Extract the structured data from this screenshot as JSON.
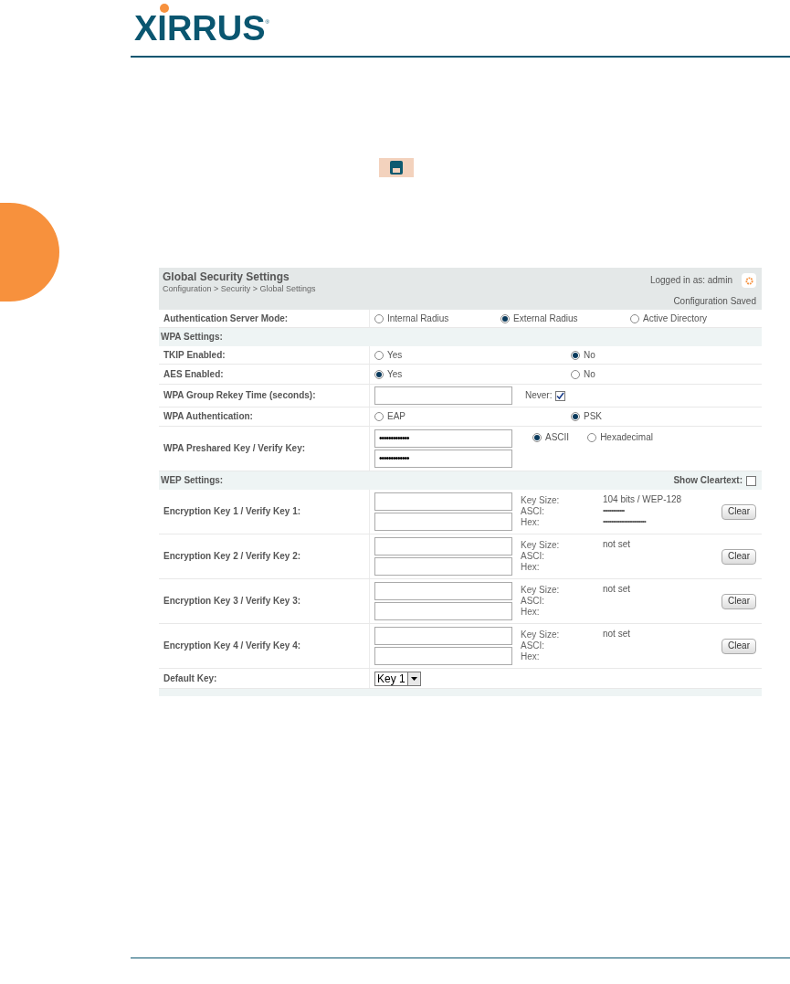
{
  "logo": {
    "name": "XIRRUS",
    "mark": "®"
  },
  "panel": {
    "title": "Global Security Settings",
    "breadcrumb": "Configuration > Security > Global Settings",
    "logged_in": "Logged in as: admin",
    "status": "Configuration Saved"
  },
  "auth_mode": {
    "label": "Authentication Server Mode:",
    "options": [
      {
        "label": "Internal Radius",
        "selected": false
      },
      {
        "label": "External Radius",
        "selected": true
      },
      {
        "label": "Active Directory",
        "selected": false
      }
    ]
  },
  "wpa_section": "WPA Settings:",
  "tkip": {
    "label": "TKIP Enabled:",
    "options": [
      {
        "label": "Yes",
        "selected": false
      },
      {
        "label": "No",
        "selected": true
      }
    ]
  },
  "aes": {
    "label": "AES Enabled:",
    "options": [
      {
        "label": "Yes",
        "selected": true
      },
      {
        "label": "No",
        "selected": false
      }
    ]
  },
  "rekey": {
    "label": "WPA Group Rekey Time (seconds):",
    "never_label": "Never:",
    "never_checked": true
  },
  "wpa_auth": {
    "label": "WPA Authentication:",
    "options": [
      {
        "label": "EAP",
        "selected": false
      },
      {
        "label": "PSK",
        "selected": true
      }
    ]
  },
  "psk": {
    "label": "WPA Preshared Key / Verify Key:",
    "key": "•••••••••••••",
    "verify": "•••••••••••••",
    "formats": [
      {
        "label": "ASCII",
        "selected": true
      },
      {
        "label": "Hexadecimal",
        "selected": false
      }
    ]
  },
  "wep_section": {
    "title": "WEP Settings:",
    "show_cleartext": "Show Cleartext:",
    "checked": false
  },
  "keys": [
    {
      "label": "Encryption Key 1 / Verify Key 1:",
      "key_size_label": "Key Size:",
      "ascii_label": "ASCI:",
      "hex_label": "Hex:",
      "key_size": "104 bits / WEP-128",
      "ascii": "•••••••••••••",
      "hex": "••••••••••••••••••••••••••",
      "clear": "Clear"
    },
    {
      "label": "Encryption Key 2 / Verify Key 2:",
      "key_size_label": "Key Size:",
      "ascii_label": "ASCI:",
      "hex_label": "Hex:",
      "key_size": "not set",
      "clear": "Clear"
    },
    {
      "label": "Encryption Key 3 / Verify Key 3:",
      "key_size_label": "Key Size:",
      "ascii_label": "ASCI:",
      "hex_label": "Hex:",
      "key_size": "not set",
      "clear": "Clear"
    },
    {
      "label": "Encryption Key 4 / Verify Key 4:",
      "key_size_label": "Key Size:",
      "ascii_label": "ASCI:",
      "hex_label": "Hex:",
      "key_size": "not set",
      "clear": "Clear"
    }
  ],
  "default_key": {
    "label": "Default Key:",
    "value": "Key 1"
  }
}
